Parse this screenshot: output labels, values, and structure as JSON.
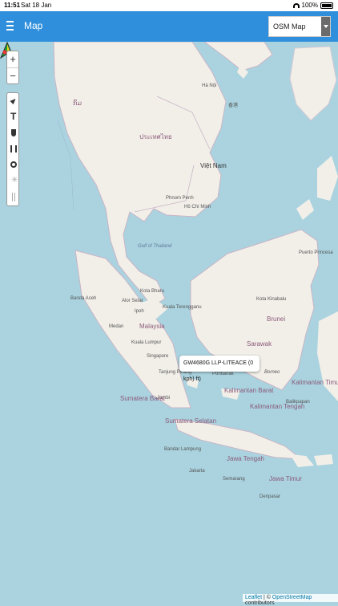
{
  "status_bar": {
    "time": "11:51",
    "date": "Sat 18 Jan",
    "battery": "100%"
  },
  "app_bar": {
    "title": "Map",
    "map_select": {
      "selected": "OSM Map"
    }
  },
  "map": {
    "places": [
      "Hà Nội",
      "Việt Nam",
      "Phnom Penh",
      "Hồ Chí Minh",
      "Puerto Princesa",
      "Banda Aceh",
      "Alor Setar",
      "Kota Bharu",
      "Kuala Terengganu",
      "Ipoh",
      "Kota Kinabalu",
      "Brunei",
      "Malaysia",
      "Kuala Lumpur",
      "Medan",
      "Singapore",
      "Tanjung Pinang",
      "Pontianak",
      "Borneo",
      "Jambi",
      "Balikpapan",
      "Bandar Lampung",
      "Jakarta",
      "Semarang",
      "Denpasar",
      "Sarawak",
      "Kalimantan Barat",
      "Kalimantan Tengah",
      "Kalimantan Timur",
      "Sumatera Selatan",
      "Sumatera Barat",
      "Jawa Tengah",
      "Jawa Timur",
      "Gulf of Thailand",
      "ประเทศไทย",
      "ກົມ",
      "香港"
    ],
    "tooltip": "GW4680G LLP-LITEACE (0 kph) ft)"
  },
  "attribution": {
    "leaflet": "Leaflet",
    "separator": "| ©",
    "osm": "OpenStreetMap",
    "suffix": "contributors"
  },
  "colors": {
    "appbar": "#2f8fdc",
    "sea": "#aad3df",
    "land": "#f2efe9"
  },
  "icons": [
    "menu-icon",
    "zoom-in-icon",
    "zoom-out-icon",
    "navigate-icon",
    "text-icon",
    "shield-icon",
    "road-icon",
    "target-icon",
    "star-icon",
    "pin-icon",
    "vehicle-marker-icon"
  ]
}
